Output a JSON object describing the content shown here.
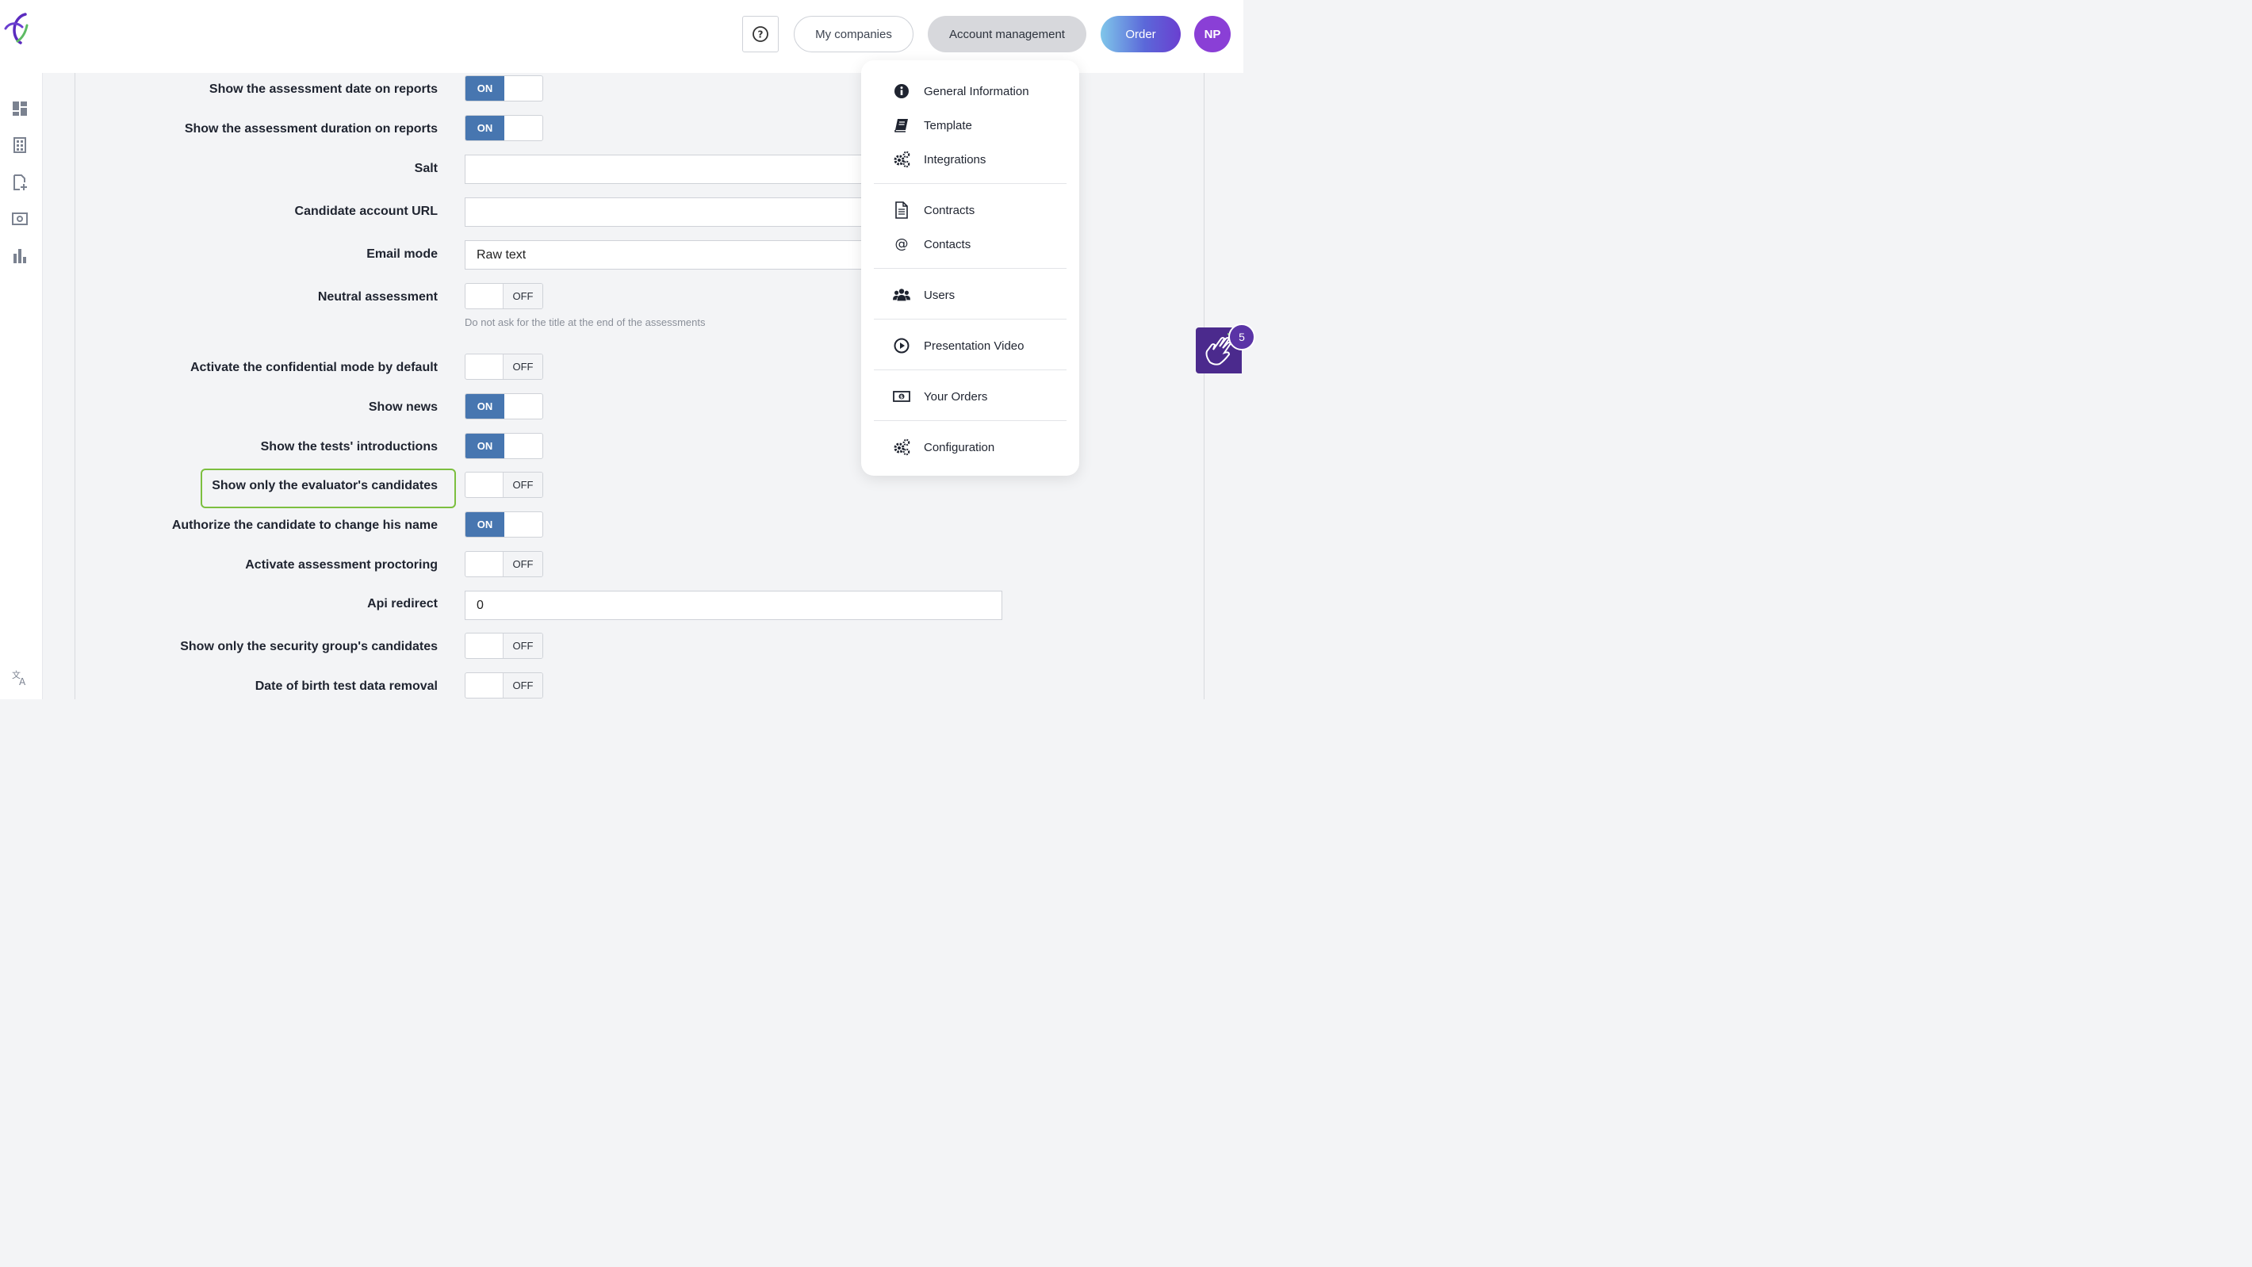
{
  "header": {
    "help_icon": "question-circle-icon",
    "my_companies": "My companies",
    "account_management": "Account management",
    "order": "Order",
    "avatar_initials": "NP"
  },
  "sidebar": {
    "expand_glyph": "»",
    "icons": [
      "dashboard-icon",
      "building-icon",
      "add-file-icon",
      "screen-icon",
      "bar-chart-icon",
      "translate-icon"
    ]
  },
  "settings": {
    "assessment_date": {
      "label": "Show the assessment date on reports",
      "state": "ON"
    },
    "assessment_duration": {
      "label": "Show the assessment duration on reports",
      "state": "ON"
    },
    "salt": {
      "label": "Salt",
      "value": ""
    },
    "candidate_url": {
      "label": "Candidate account URL",
      "value": ""
    },
    "email_mode": {
      "label": "Email mode",
      "value": "Raw text"
    },
    "neutral_assessment": {
      "label": "Neutral assessment",
      "state": "OFF",
      "hint": "Do not ask for the title at the end of the assessments"
    },
    "confidential_mode": {
      "label": "Activate the confidential mode by default",
      "state": "OFF"
    },
    "show_news": {
      "label": "Show news",
      "state": "ON"
    },
    "tests_intro": {
      "label": "Show the tests' introductions",
      "state": "ON"
    },
    "evaluator_candidates": {
      "label": "Show only the evaluator's candidates",
      "state": "OFF"
    },
    "change_name": {
      "label": "Authorize the candidate to change his name",
      "state": "ON"
    },
    "proctoring": {
      "label": "Activate assessment proctoring",
      "state": "OFF"
    },
    "api_redirect": {
      "label": "Api redirect",
      "value": "0"
    },
    "security_group": {
      "label": "Show only the security group's candidates",
      "state": "OFF"
    },
    "dob_removal": {
      "label": "Date of birth test data removal",
      "state": "OFF"
    }
  },
  "menu": {
    "general_information": "General Information",
    "template": "Template",
    "integrations": "Integrations",
    "contracts": "Contracts",
    "contacts": "Contacts",
    "users": "Users",
    "presentation_video": "Presentation Video",
    "your_orders": "Your Orders",
    "configuration": "Configuration"
  },
  "widget": {
    "badge_count": "5"
  },
  "colors": {
    "toggle_on": "#4776b0",
    "highlight": "#7cbf3f",
    "avatar": "#8a3fd6"
  }
}
